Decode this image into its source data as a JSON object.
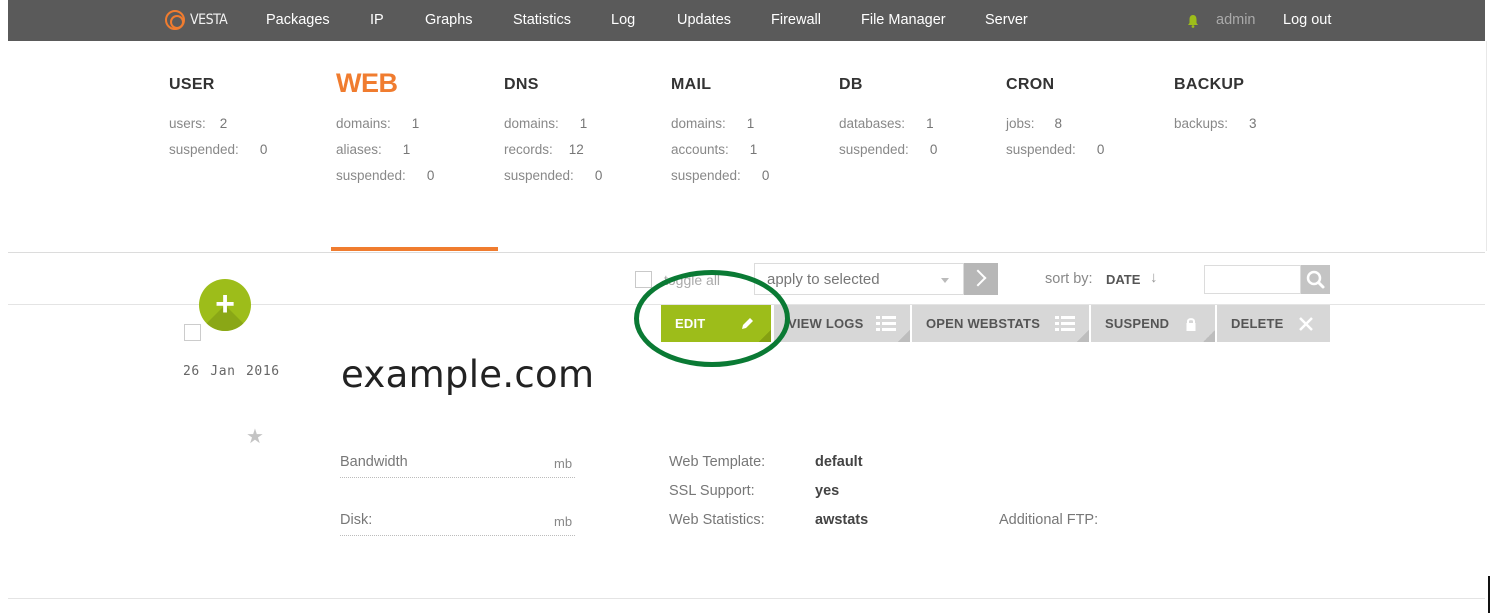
{
  "nav": {
    "logo_text": "VESTA",
    "items": [
      "Packages",
      "IP",
      "Graphs",
      "Statistics",
      "Log",
      "Updates",
      "Firewall",
      "File Manager",
      "Server"
    ],
    "user": "admin",
    "logout": "Log out"
  },
  "stats": [
    {
      "title": "USER",
      "active": false,
      "rows": [
        {
          "k": "users:",
          "v": "2"
        },
        {
          "k": "suspended:",
          "v": "0"
        }
      ]
    },
    {
      "title": "WEB",
      "active": true,
      "rows": [
        {
          "k": "domains:",
          "v": "1"
        },
        {
          "k": "aliases:",
          "v": "1"
        },
        {
          "k": "suspended:",
          "v": "0"
        }
      ]
    },
    {
      "title": "DNS",
      "active": false,
      "rows": [
        {
          "k": "domains:",
          "v": "1"
        },
        {
          "k": "records:",
          "v": "12"
        },
        {
          "k": "suspended:",
          "v": "0"
        }
      ]
    },
    {
      "title": "MAIL",
      "active": false,
      "rows": [
        {
          "k": "domains:",
          "v": "1"
        },
        {
          "k": "accounts:",
          "v": "1"
        },
        {
          "k": "suspended:",
          "v": "0"
        }
      ]
    },
    {
      "title": "DB",
      "active": false,
      "rows": [
        {
          "k": "databases:",
          "v": "1"
        },
        {
          "k": "suspended:",
          "v": "0"
        }
      ]
    },
    {
      "title": "CRON",
      "active": false,
      "rows": [
        {
          "k": "jobs:",
          "v": "8"
        },
        {
          "k": "suspended:",
          "v": "0"
        }
      ]
    },
    {
      "title": "BACKUP",
      "active": false,
      "rows": [
        {
          "k": "backups:",
          "v": "3"
        }
      ]
    }
  ],
  "toolbar": {
    "toggle_all": "toggle all",
    "apply_selected": "apply to selected",
    "sort_label": "sort by:",
    "sort_value": "DATE",
    "sort_arrow": "↓",
    "search_value": ""
  },
  "row": {
    "date": "26 Jan 2016",
    "domain": "example.com",
    "star": "★",
    "actions": [
      {
        "label": "EDIT",
        "icon": "pencil-icon"
      },
      {
        "label": "VIEW LOGS",
        "icon": "list-icon"
      },
      {
        "label": "OPEN WEBSTATS",
        "icon": "list-icon"
      },
      {
        "label": "SUSPEND",
        "icon": "lock-icon"
      },
      {
        "label": "DELETE",
        "icon": "close-icon"
      }
    ],
    "details": {
      "bandwidth_label": "Bandwidth",
      "bandwidth_unit": "mb",
      "disk_label": "Disk:",
      "disk_unit": "mb",
      "web_template_label": "Web Template:",
      "web_template_value": "default",
      "ssl_label": "SSL Support:",
      "ssl_value": "yes",
      "web_stats_label": "Web Statistics:",
      "web_stats_value": "awstats",
      "ftp_label": "Additional FTP:"
    }
  },
  "colors": {
    "accent_orange": "#f07c2f",
    "accent_green": "#9dbd1a",
    "topbar": "#5a5a5a",
    "highlight_ring": "#0a7a34"
  }
}
